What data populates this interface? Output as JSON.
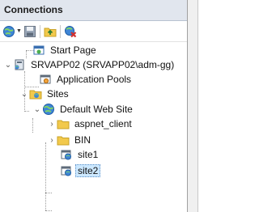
{
  "panel": {
    "title": "Connections"
  },
  "toolbar": {
    "icons": [
      "connect-globe-icon",
      "save-icon",
      "up-folder-icon",
      "disconnect-icon"
    ]
  },
  "tree": {
    "start_page": "Start Page",
    "server": "SRVAPP02 (SRVAPP02\\adm-gg)",
    "app_pools": "Application Pools",
    "sites": "Sites",
    "default_site": "Default Web Site",
    "aspnet_client": "aspnet_client",
    "bin": "BIN",
    "site1": "site1",
    "site2": "site2"
  }
}
